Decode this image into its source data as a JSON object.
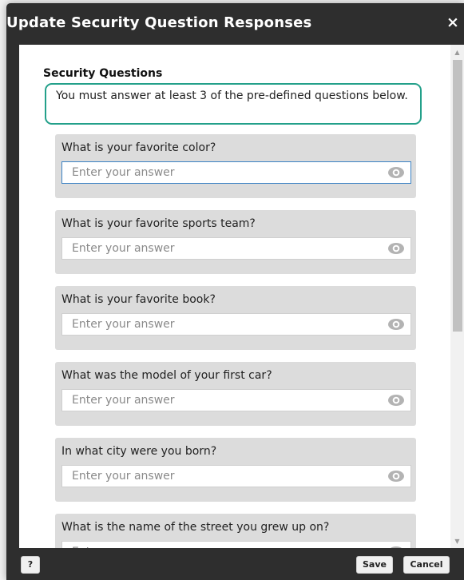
{
  "dialog": {
    "title": "Update Security Question Responses",
    "close_label": "×"
  },
  "section": {
    "title": "Security Questions",
    "notice": "You must answer at least 3 of the pre-defined questions below."
  },
  "questions": [
    {
      "label": "What is your favorite color?",
      "placeholder": "Enter your answer"
    },
    {
      "label": "What is your favorite sports team?",
      "placeholder": "Enter your answer"
    },
    {
      "label": "What is your favorite book?",
      "placeholder": "Enter your answer"
    },
    {
      "label": "What was the model of your first car?",
      "placeholder": "Enter your answer"
    },
    {
      "label": "In what city were you born?",
      "placeholder": "Enter your answer"
    },
    {
      "label": "What is the name of the street you grew up on?",
      "placeholder": "Enter your answer"
    }
  ],
  "footer": {
    "help_label": "?",
    "save_label": "Save",
    "cancel_label": "Cancel"
  },
  "icons": {
    "close": "close-icon",
    "reveal": "eye-icon",
    "scroll_up": "scroll-up-arrow",
    "scroll_down": "scroll-down-arrow"
  },
  "colors": {
    "header_bg": "#2e2e2e",
    "notice_border": "#23a08a",
    "card_bg": "#dcdcdc",
    "focus_border": "#3b82c4"
  }
}
